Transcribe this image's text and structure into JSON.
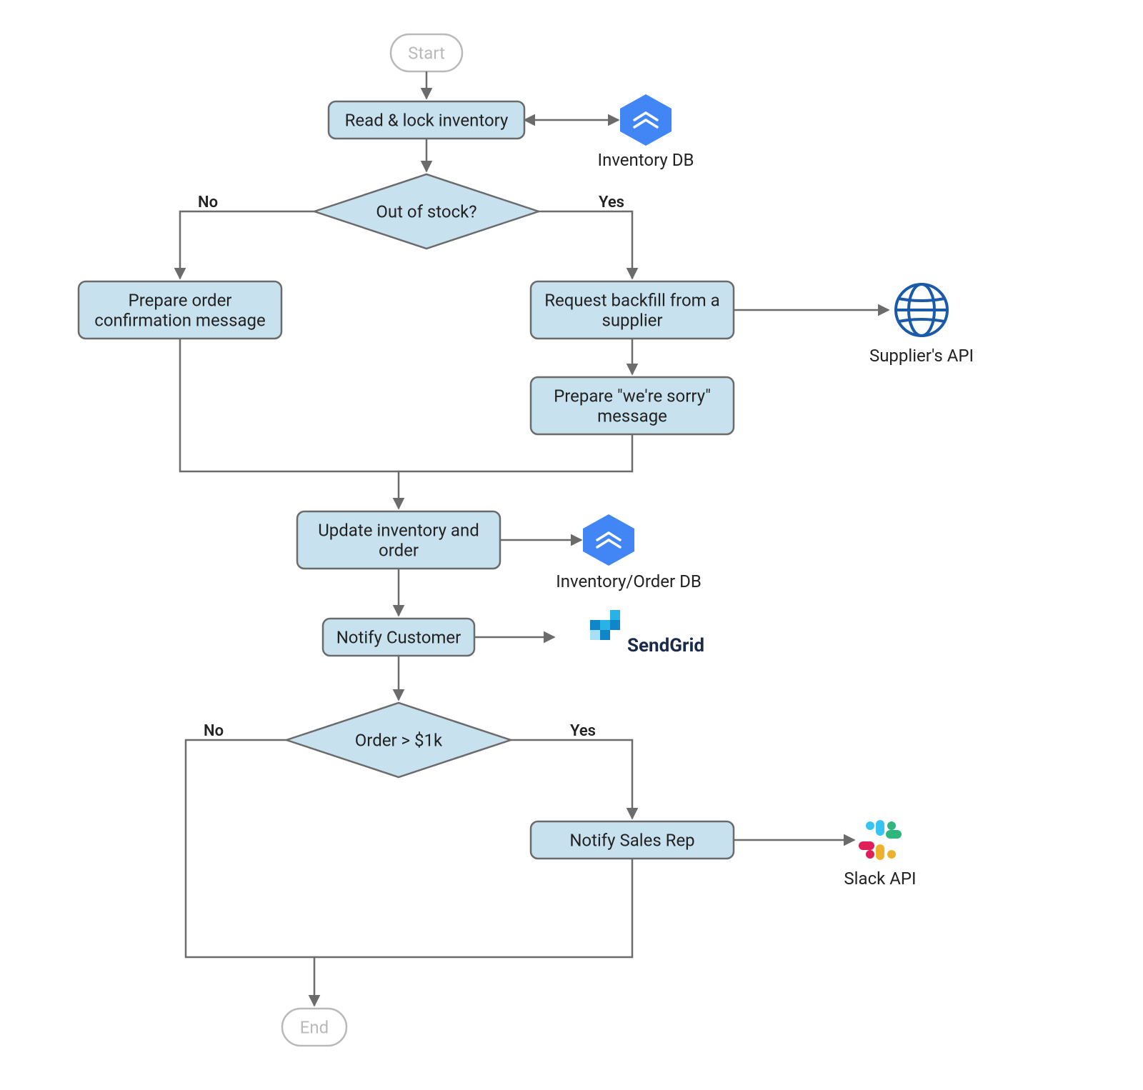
{
  "nodes": {
    "start": "Start",
    "end": "End",
    "readLock": "Read & lock inventory",
    "outOfStock": "Out of stock?",
    "prepConfirm1": "Prepare order",
    "prepConfirm2": "confirmation message",
    "requestBackfill1": "Request backfill from a",
    "requestBackfill2": "supplier",
    "prepSorry1": "Prepare \"we're sorry\"",
    "prepSorry2": "message",
    "updateInv1": "Update inventory and",
    "updateInv2": "order",
    "notifyCustomer": "Notify Customer",
    "orderGt1k": "Order > $1k",
    "notifySales": "Notify Sales Rep"
  },
  "edgeLabels": {
    "no": "No",
    "yes": "Yes"
  },
  "externals": {
    "inventoryDb": "Inventory DB",
    "supplierApi": "Supplier's API",
    "inventoryOrderDb": "Inventory/Order DB",
    "sendgrid": "SendGrid",
    "slackApi": "Slack API"
  }
}
